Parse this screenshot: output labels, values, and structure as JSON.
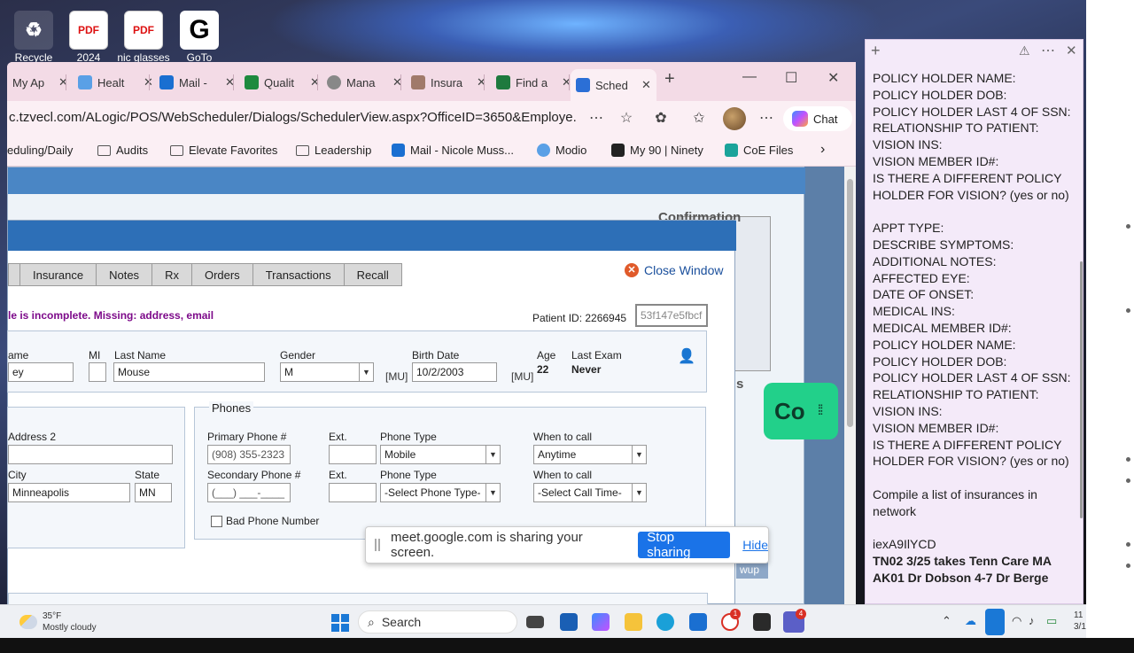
{
  "desktop": {
    "icons": [
      {
        "label": "Recycle Bin",
        "icon": "recycle-bin-icon",
        "glyph": "♻"
      },
      {
        "label": "2024",
        "icon": "pdf-icon",
        "glyph": "PDF"
      },
      {
        "label": "nic glasses",
        "icon": "pdf-icon",
        "glyph": "PDF"
      },
      {
        "label": "GoTo",
        "icon": "goto-icon",
        "glyph": "G"
      }
    ]
  },
  "browser": {
    "tabs": [
      {
        "label": "My Ap",
        "color": "#e07a2a"
      },
      {
        "label": "Healt",
        "color": "#5aa0e6"
      },
      {
        "label": "Mail -",
        "color": "#1a6fd1"
      },
      {
        "label": "Qualit",
        "color": "#1e8a3e"
      },
      {
        "label": "Mana",
        "color": "#888888"
      },
      {
        "label": "Insura",
        "color": "#a07a6a"
      },
      {
        "label": "Find a",
        "color": "#1e7a3e"
      },
      {
        "label": "Sched",
        "color": "#2b6fd6"
      }
    ],
    "new_tab": "+",
    "url": "c.tzvecl.com/ALogic/POS/WebScheduler/Dialogs/SchedulerView.aspx?OfficeID=3650&Employe...",
    "chat_label": "Chat",
    "favorites": [
      {
        "label": "eduling/Daily",
        "type": "text"
      },
      {
        "label": "Audits",
        "type": "folder"
      },
      {
        "label": "Elevate Favorites",
        "type": "folder"
      },
      {
        "label": "Leadership",
        "type": "folder"
      },
      {
        "label": "Mail - Nicole Muss...",
        "type": "mail"
      },
      {
        "label": "Modio",
        "type": "modio"
      },
      {
        "label": "My 90 | Ninety",
        "type": "ninety"
      },
      {
        "label": "CoE Files",
        "type": "coe"
      }
    ]
  },
  "app": {
    "confirmation_label": "Confirmation",
    "side_letter": "s",
    "tabs": [
      "Insurance",
      "Notes",
      "Rx",
      "Orders",
      "Transactions",
      "Recall"
    ],
    "close_window": "Close Window",
    "warning": "le is incomplete. Missing: address, email",
    "patient_id_label": "Patient ID: 2266945",
    "patient_id_box": "53f147e5fbcf",
    "name": {
      "first_label": "ame",
      "first_value": "ey",
      "mi_label": "MI",
      "mi_value": "",
      "last_label": "Last Name",
      "last_value": "Mouse",
      "gender_label": "Gender",
      "gender_value": "M",
      "mu1": "[MU]",
      "birth_label": "Birth Date",
      "birth_value": "10/2/2003",
      "mu2": "[MU]",
      "age_label": "Age",
      "age_value": "22",
      "last_exam_label": "Last Exam",
      "last_exam_value": "Never"
    },
    "address": {
      "address2_label": "Address 2",
      "address2_value": "",
      "city_label": "City",
      "city_value": "Minneapolis",
      "state_label": "State",
      "state_value": "MN"
    },
    "phones": {
      "title": "Phones",
      "primary_label": "Primary Phone #",
      "primary_value": "(908) 355-2323",
      "ext_label": "Ext.",
      "phone_type_label": "Phone Type",
      "phone_type_value": "Mobile",
      "when_label": "When to call",
      "when_value": "Anytime",
      "secondary_label": "Secondary Phone #",
      "secondary_value": "(___) ___-____",
      "ext2_label": "Ext.",
      "phone_type2_label": "Phone Type",
      "phone_type2_value": "-Select Phone Type-",
      "when2_label": "When to call",
      "when2_value": "-Select Call Time-",
      "bad_phone_label": "Bad Phone Number"
    },
    "wup_label": "wup"
  },
  "share": {
    "text": "meet.google.com is sharing your screen.",
    "stop": "Stop sharing",
    "hide": "Hide"
  },
  "co_widget": {
    "label": "Co"
  },
  "note": {
    "lines": [
      "POLICY HOLDER NAME:",
      "POLICY HOLDER DOB:",
      "POLICY HOLDER LAST 4 OF SSN:",
      "RELATIONSHIP TO PATIENT:",
      "VISION INS:",
      "VISION MEMBER ID#:",
      "IS THERE A DIFFERENT POLICY",
      "HOLDER FOR VISION? (yes or no)",
      "",
      "APPT TYPE:",
      "DESCRIBE SYMPTOMS:",
      "ADDITIONAL NOTES:",
      "AFFECTED EYE:",
      "DATE OF ONSET:",
      "MEDICAL INS:",
      "MEDICAL MEMBER ID#:",
      "POLICY HOLDER NAME:",
      "POLICY HOLDER DOB:",
      "POLICY HOLDER LAST 4 OF SSN:",
      "RELATIONSHIP TO PATIENT:",
      "VISION INS:",
      "VISION MEMBER ID#:",
      "IS THERE A DIFFERENT POLICY",
      "HOLDER FOR VISION? (yes or no)",
      "",
      "Compile a list of insurances in",
      "network",
      "",
      "iexA9IlYCD"
    ],
    "bold_lines": [
      "TN02 3/25 takes Tenn Care MA",
      "AK01 Dr Dobson 4-7 Dr Berge"
    ]
  },
  "taskbar": {
    "temp": "35°F",
    "condition": "Mostly cloudy",
    "search_label": "Search",
    "badge1": "1",
    "badge2": "4",
    "clock_time": "11",
    "clock_date": "3/1"
  }
}
